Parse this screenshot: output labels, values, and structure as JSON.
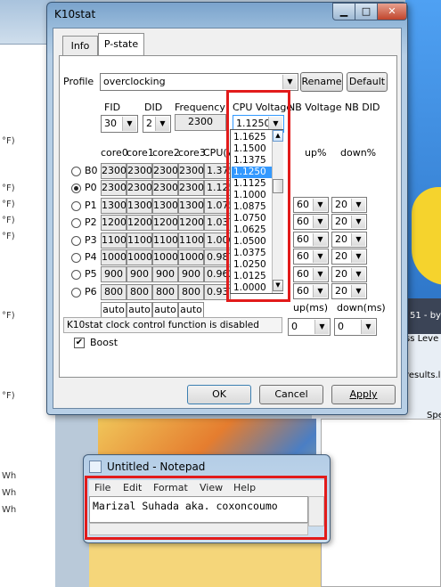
{
  "background": {
    "left_rows": [
      "°F)",
      "°F)",
      "°F)",
      "°F)",
      "°F)",
      "°F)",
      "°F)",
      "Wh",
      "Wh",
      "Wh"
    ],
    "right_texts": [
      "51 - by",
      "ss Leve",
      "results.l",
      "Spe"
    ]
  },
  "k10": {
    "title": "K10stat",
    "tabs": [
      "Info",
      "P-state"
    ],
    "profile_label": "Profile",
    "profile_value": "overclocking",
    "rename_label": "Rename",
    "default_label": "Default",
    "col_fid": "FID",
    "col_did": "DID",
    "col_frequency": "Frequency",
    "col_cpu_voltage": "CPU Voltage",
    "col_nb_voltage": "NB Voltage",
    "col_nb_did": "NB DID",
    "fid_value": "30",
    "did_value": "2",
    "frequency_value": "2300",
    "cpu_voltage_value": "1.1250",
    "core_headers": [
      "core0",
      "core1",
      "core2",
      "core3",
      "CPU(V)"
    ],
    "up_pct_label": "up%",
    "down_pct_label": "down%",
    "rows": [
      {
        "name": "B0",
        "cores": [
          "2300",
          "2300",
          "2300",
          "2300"
        ],
        "cpuv": "1.3750",
        "selected": false
      },
      {
        "name": "P0",
        "cores": [
          "2300",
          "2300",
          "2300",
          "2300"
        ],
        "cpuv": "1.1250",
        "selected": true
      },
      {
        "name": "P1",
        "cores": [
          "1300",
          "1300",
          "1300",
          "1300"
        ],
        "cpuv": "1.0750",
        "selected": false
      },
      {
        "name": "P2",
        "cores": [
          "1200",
          "1200",
          "1200",
          "1200"
        ],
        "cpuv": "1.0375",
        "selected": false
      },
      {
        "name": "P3",
        "cores": [
          "1100",
          "1100",
          "1100",
          "1100"
        ],
        "cpuv": "1.0000",
        "selected": false
      },
      {
        "name": "P4",
        "cores": [
          "1000",
          "1000",
          "1000",
          "1000"
        ],
        "cpuv": "0.9875",
        "selected": false
      },
      {
        "name": "P5",
        "cores": [
          "900",
          "900",
          "900",
          "900"
        ],
        "cpuv": "0.9625",
        "selected": false
      },
      {
        "name": "P6",
        "cores": [
          "800",
          "800",
          "800",
          "800"
        ],
        "cpuv": "0.9375",
        "selected": false
      }
    ],
    "up_values": [
      "60",
      "60",
      "60",
      "60",
      "60",
      "60"
    ],
    "down_values": [
      "20",
      "20",
      "20",
      "20",
      "20",
      "20"
    ],
    "auto_labels": [
      "auto",
      "auto",
      "auto",
      "auto"
    ],
    "up_ms_label": "up(ms)",
    "down_ms_label": "down(ms)",
    "up_ms_value": "0",
    "down_ms_value": "0",
    "status_text": "K10stat clock control function is disabled",
    "boost_label": "Boost",
    "boost_checked": true,
    "ok_label": "OK",
    "cancel_label": "Cancel",
    "apply_label": "Apply",
    "voltage_dropdown": [
      "1.1625",
      "1.1500",
      "1.1375",
      "1.1250",
      "1.1125",
      "1.1000",
      "1.0875",
      "1.0750",
      "1.0625",
      "1.0500",
      "1.0375",
      "1.0250",
      "1.0125",
      "1.0000"
    ],
    "voltage_selected_index": 3
  },
  "notepad": {
    "title": "Untitled - Notepad",
    "menu": [
      "File",
      "Edit",
      "Format",
      "View",
      "Help"
    ],
    "text": "Marizal Suhada aka. coxoncoumo"
  },
  "colors": {
    "highlight_box": "#e21b1b",
    "selection": "#3399ff"
  }
}
